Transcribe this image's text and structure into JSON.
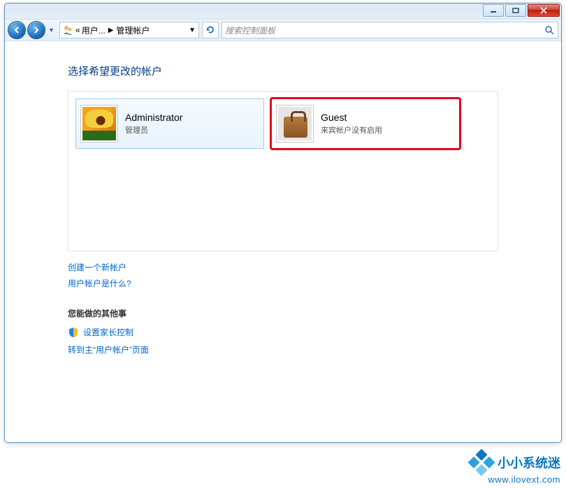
{
  "window": {
    "minimize_icon": "minimize",
    "maximize_icon": "maximize",
    "close_icon": "close"
  },
  "nav": {
    "back_icon": "arrow-left",
    "forward_icon": "arrow-right",
    "crumb_prefix": "«",
    "crumb_item1": "用户...",
    "crumb_item2": "管理帐户",
    "refresh_icon": "refresh",
    "search_placeholder": "搜索控制面板",
    "search_icon": "search"
  },
  "page": {
    "heading": "选择希望更改的帐户",
    "accounts": [
      {
        "name": "Administrator",
        "role": "管理员",
        "picture": "flower",
        "selected": true,
        "highlighted": false
      },
      {
        "name": "Guest",
        "role": "来宾帐户没有启用",
        "picture": "suitcase",
        "selected": false,
        "highlighted": true
      }
    ],
    "link_create": "创建一个新帐户",
    "link_whatis": "用户帐户是什么?",
    "other_label": "您能做的其他事",
    "link_parental": "设置家长控制",
    "link_goto_main": "转到主“用户帐户”页面"
  },
  "watermark": {
    "title": "小小系统迷",
    "url": "www.ilovext.com"
  }
}
